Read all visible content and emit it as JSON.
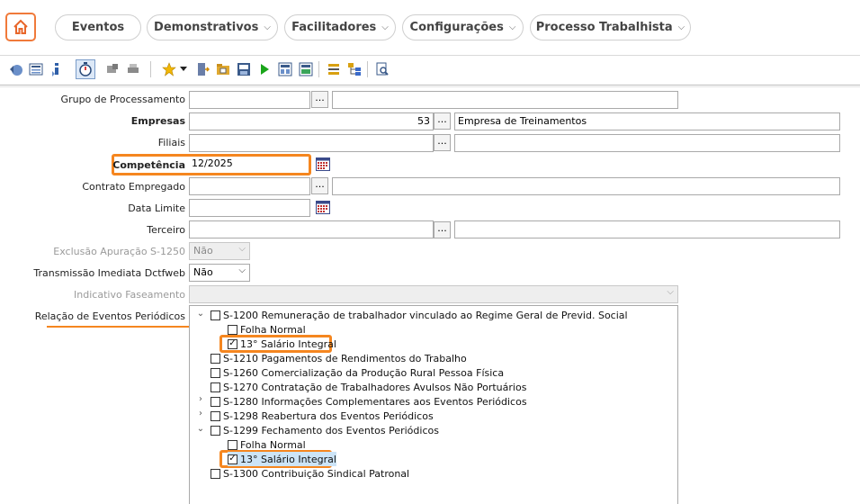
{
  "nav": {
    "items": [
      {
        "label": "Eventos",
        "dropdown": false
      },
      {
        "label": "Demonstrativos",
        "dropdown": true
      },
      {
        "label": "Facilitadores",
        "dropdown": true
      },
      {
        "label": "Configurações",
        "dropdown": true
      },
      {
        "label": "Processo Trabalhista",
        "dropdown": true
      }
    ],
    "chevron": "⌵"
  },
  "form": {
    "grupo_label": "Grupo de Processamento",
    "empresas_label": "Empresas",
    "empresas_code": "53",
    "empresas_name": "Empresa de Treinamentos",
    "filiais_label": "Filiais",
    "competencia_label": "Competência",
    "competencia_value": "12/2025",
    "contrato_label": "Contrato Empregado",
    "data_limite_label": "Data Limite",
    "terceiro_label": "Terceiro",
    "exclusao_label": "Exclusão Apuração S-1250",
    "exclusao_value": "Não",
    "transmissao_label": "Transmissão Imediata Dctfweb",
    "transmissao_value": "Não",
    "indicativo_label": "Indicativo Faseamento",
    "indicativo_value": "",
    "relacao_label": "Relação de Eventos Periódicos",
    "dots": "..."
  },
  "tree": [
    {
      "label": "S-1200 Remuneração de trabalhador vinculado ao Regime Geral de Previd. Social",
      "level": 0,
      "expander": "open",
      "checked": false
    },
    {
      "label": "Folha Normal",
      "level": 1,
      "expander": "none",
      "checked": false
    },
    {
      "label": "13° Salário Integral",
      "level": 1,
      "expander": "none",
      "checked": true
    },
    {
      "label": "S-1210 Pagamentos de Rendimentos do Trabalho",
      "level": 0,
      "expander": "none",
      "checked": false
    },
    {
      "label": "S-1260 Comercialização da Produção Rural Pessoa Física",
      "level": 0,
      "expander": "none",
      "checked": false
    },
    {
      "label": "S-1270 Contratação de Trabalhadores Avulsos Não Portuários",
      "level": 0,
      "expander": "none",
      "checked": false
    },
    {
      "label": "S-1280 Informações Complementares aos Eventos Periódicos",
      "level": 0,
      "expander": "closed",
      "checked": false
    },
    {
      "label": "S-1298 Reabertura dos Eventos Periódicos",
      "level": 0,
      "expander": "closed",
      "checked": false
    },
    {
      "label": "S-1299 Fechamento dos Eventos Periódicos",
      "level": 0,
      "expander": "open",
      "checked": false
    },
    {
      "label": "Folha Normal",
      "level": 1,
      "expander": "none",
      "checked": false
    },
    {
      "label": "13° Salário Integral",
      "level": 1,
      "expander": "none",
      "checked": true
    },
    {
      "label": "S-1300 Contribuição Sindical Patronal",
      "level": 0,
      "expander": "none",
      "checked": false
    }
  ],
  "colors": {
    "accent": "#f5861f",
    "home_border": "#f07a3a"
  }
}
